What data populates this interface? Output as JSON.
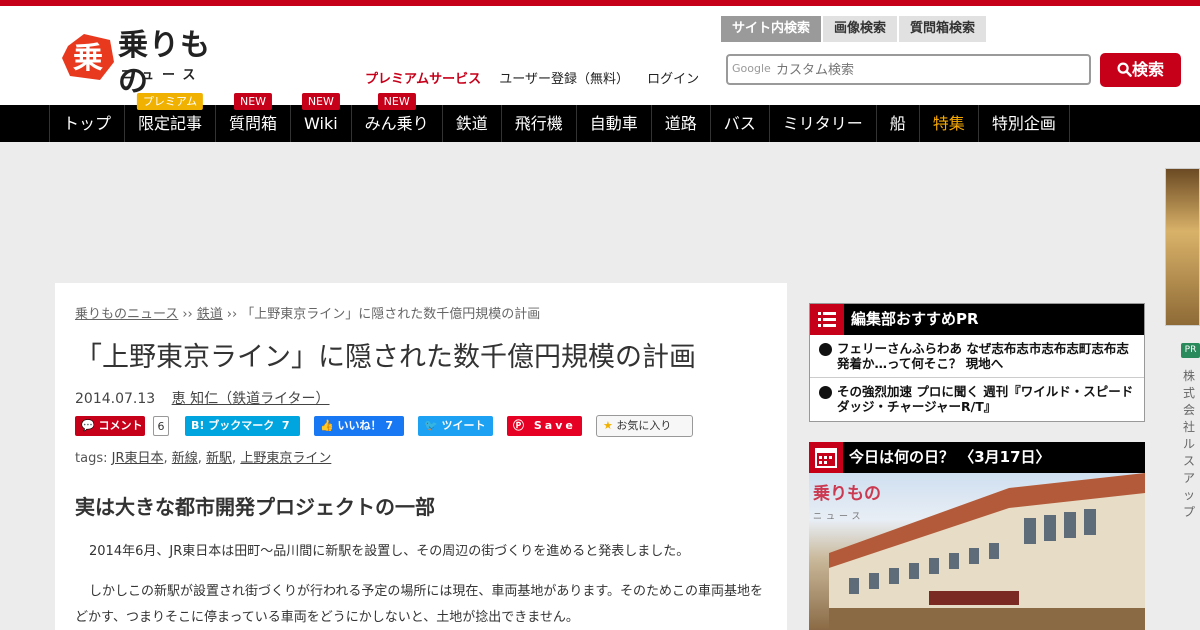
{
  "header": {
    "logo": {
      "title": "乗りもの",
      "subtitle": "ニュース"
    },
    "links": {
      "premium": "プレミアムサービス",
      "register": "ユーザー登録（無料）",
      "login": "ログイン"
    },
    "search": {
      "tabs": [
        "サイト内検索",
        "画像検索",
        "質問箱検索"
      ],
      "provider": "Google",
      "placeholder": "カスタム検索",
      "button": "検索"
    }
  },
  "nav": {
    "items": [
      {
        "label": "トップ",
        "badge": ""
      },
      {
        "label": "限定記事",
        "badge": "プレミアム"
      },
      {
        "label": "質問箱",
        "badge": "NEW"
      },
      {
        "label": "Wiki",
        "badge": "NEW"
      },
      {
        "label": "みん乗り",
        "badge": "NEW"
      },
      {
        "label": "鉄道",
        "badge": ""
      },
      {
        "label": "飛行機",
        "badge": ""
      },
      {
        "label": "自動車",
        "badge": ""
      },
      {
        "label": "道路",
        "badge": ""
      },
      {
        "label": "バス",
        "badge": ""
      },
      {
        "label": "ミリタリー",
        "badge": ""
      },
      {
        "label": "船",
        "badge": ""
      },
      {
        "label": "特集",
        "badge": ""
      },
      {
        "label": "特別企画",
        "badge": ""
      }
    ]
  },
  "article": {
    "breadcrumb": [
      "乗りものニュース",
      "鉄道",
      "「上野東京ライン」に隠された数千億円規模の計画"
    ],
    "title": "「上野東京ライン」に隠された数千億円規模の計画",
    "date": "2014.07.13",
    "author": "恵 知仁（鉄道ライター）",
    "share": {
      "comment": "コメント",
      "comment_count": "6",
      "hatena": "ブックマーク",
      "hatena_count": "7",
      "like": "いいね！",
      "like_count": "7",
      "tweet": "ツイート",
      "save": "Save",
      "favorite": "お気に入り"
    },
    "tags_label": "tags:",
    "tags": [
      "JR東日本",
      "新線",
      "新駅",
      "上野東京ライン"
    ],
    "heading": "実は大きな都市開発プロジェクトの一部",
    "paragraphs": [
      "2014年6月、JR東日本は田町～品川間に新駅を設置し、その周辺の街づくりを進めると発表しました。",
      "しかしこの新駅が設置され街づくりが行われる予定の場所には現在、車両基地があります。そのためこの車両基地をどかす、つまりそこに停まっている車両をどうにかしないと、土地が捻出できません。"
    ]
  },
  "sidebar": {
    "pr": {
      "title": "編集部おすすめPR",
      "items": [
        "フェリーさんふらわあ なぜ志布志市志布志町志布志発着か…って何そこ？ 現地へ",
        "その強烈加速 プロに聞く 週刊『ワイルド・スピード ダッジ・チャージャーR/T』"
      ]
    },
    "today": {
      "title": "今日は何の日？ 〈3月17日〉",
      "image_logo": "乗りもの",
      "image_logo_sub": "ニュース"
    },
    "right_ad": {
      "pr_badge": "PR",
      "vertical_text": "株式会社ルスアップ"
    }
  }
}
